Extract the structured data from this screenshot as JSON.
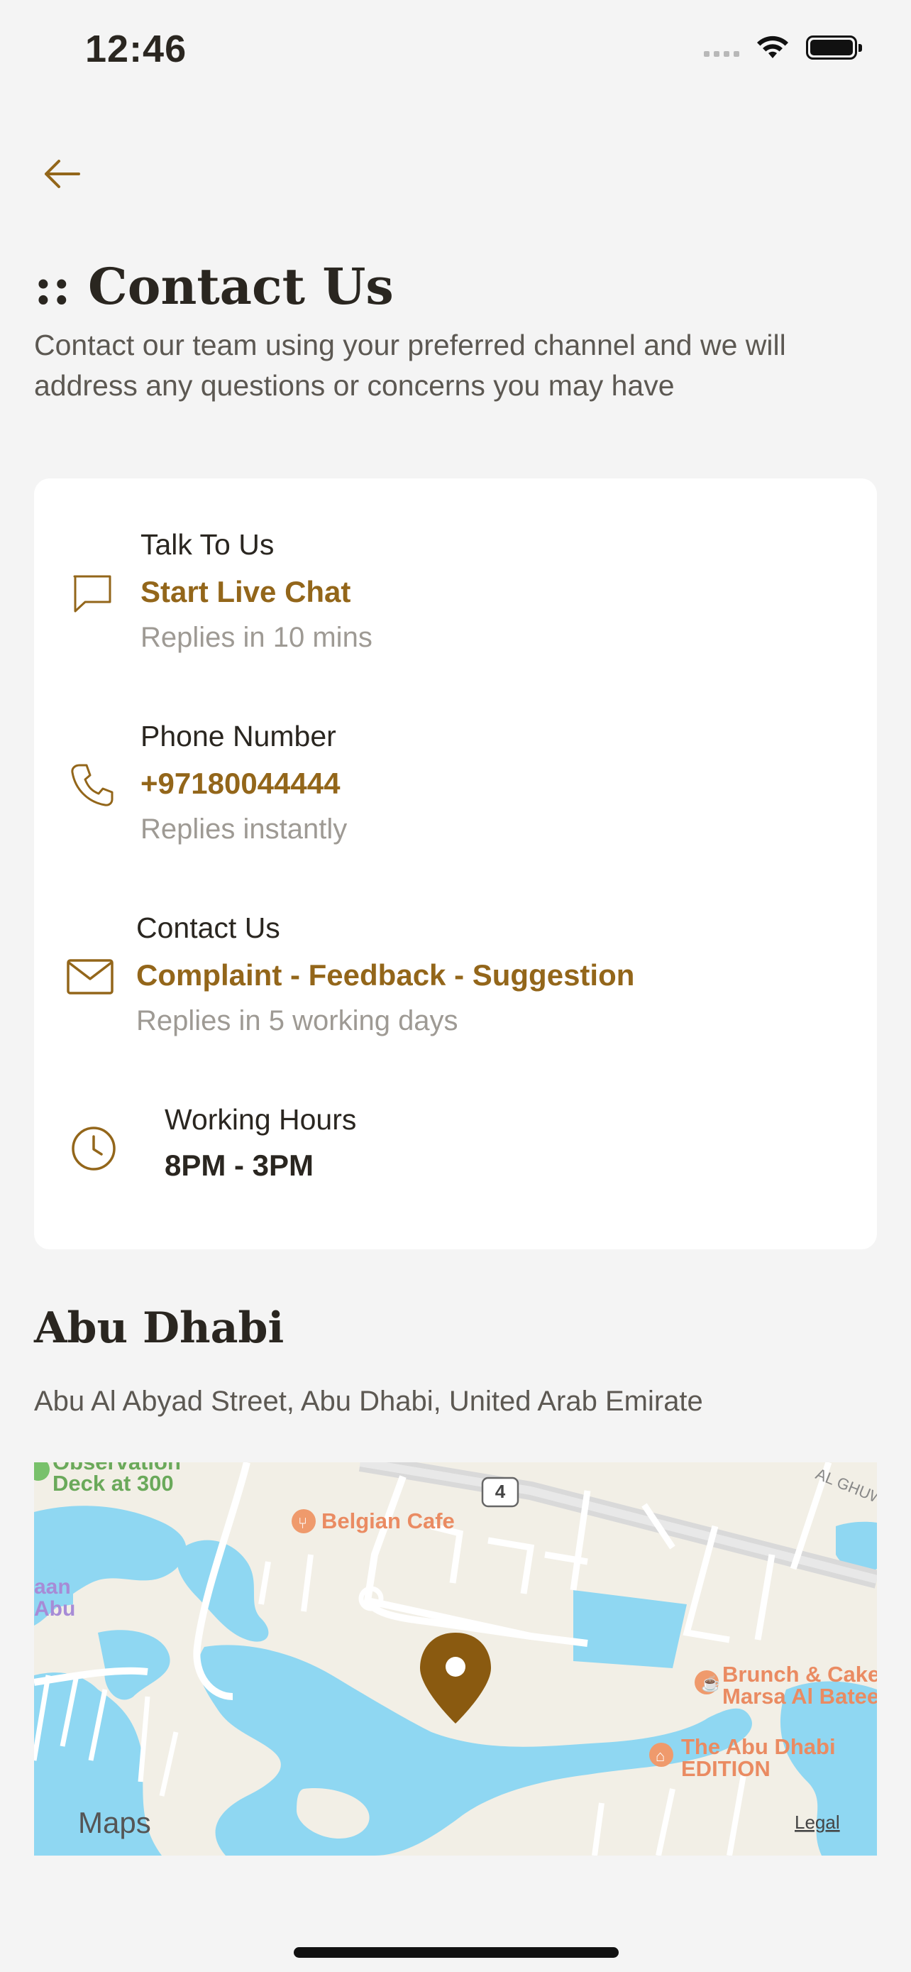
{
  "status_bar": {
    "time": "12:46"
  },
  "header": {
    "title": ":: Contact Us",
    "subtitle": "Contact our team using your preferred channel and we will address any questions or concerns you may have"
  },
  "contact": {
    "chat": {
      "label": "Talk To Us",
      "value": "Start Live Chat",
      "note": "Replies in 10 mins",
      "icon": "chat-bubble-icon"
    },
    "phone": {
      "label": "Phone Number",
      "value": "+97180044444",
      "note": "Replies instantly",
      "icon": "phone-icon"
    },
    "email": {
      "label": "Contact Us",
      "value": "Complaint - Feedback - Suggestion",
      "note": "Replies in 5 working days",
      "icon": "mail-icon"
    },
    "hours": {
      "label": "Working Hours",
      "value": "8PM - 3PM",
      "icon": "clock-icon"
    }
  },
  "location": {
    "city": "Abu Dhabi",
    "address": "Abu Al Abyad Street, Abu Dhabi, United Arab Emirate"
  },
  "map": {
    "labels": {
      "observation": "Observation",
      "deck": "Deck at 300",
      "belgian": "Belgian Cafe",
      "road_number": "4",
      "ghuw": "AL GHUW",
      "aan": "aan",
      "abu": "Abu",
      "brunch1": "Brunch & Cake",
      "brunch2": "Marsa Al Bateen",
      "edition1": "The Abu Dhabi",
      "edition2": "EDITION",
      "maps_brand": "Maps",
      "legal": "Legal"
    }
  },
  "colors": {
    "accent": "#93661a",
    "water": "#8fd7f2",
    "land": "#f2efe6"
  }
}
